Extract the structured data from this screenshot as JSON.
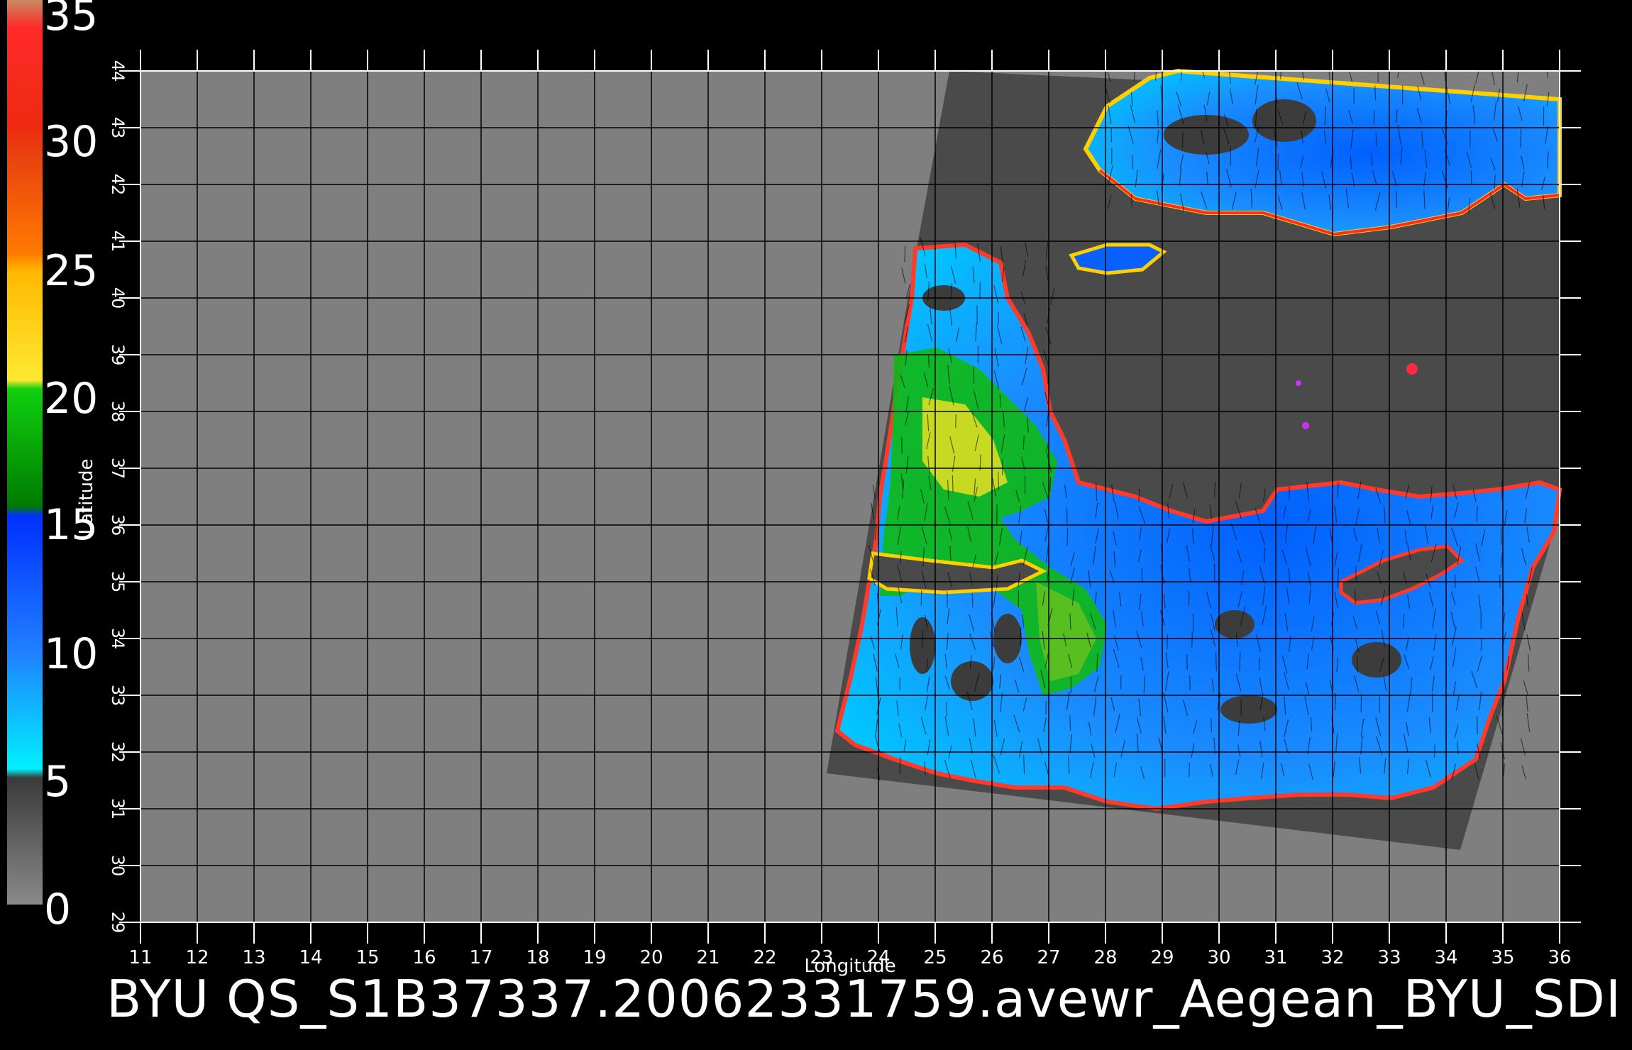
{
  "footer_title": "BYU  QS_S1B37337.20062331759.avewr_Aegean_BYU_SDI",
  "colorbar": {
    "labels": [
      "35",
      "30",
      "25",
      "20",
      "15",
      "10",
      "5",
      "0"
    ],
    "colors": [
      "#b97a57",
      "#ff2020",
      "#f05a10",
      "#ffd000",
      "#00c000",
      "#0050ff",
      "#00e8ff",
      "#606060"
    ]
  },
  "map": {
    "xlabel": "Longitude",
    "ylabel": "Latitude",
    "x_ticks": [
      "11",
      "12",
      "13",
      "14",
      "15",
      "16",
      "17",
      "18",
      "19",
      "20",
      "21",
      "22",
      "23",
      "24",
      "25",
      "26",
      "27",
      "28",
      "29",
      "30",
      "31",
      "32",
      "33",
      "34",
      "35",
      "36"
    ],
    "y_ticks": [
      "29",
      "30",
      "31",
      "32",
      "33",
      "34",
      "35",
      "36",
      "37",
      "38",
      "39",
      "40",
      "41",
      "42",
      "43",
      "44"
    ],
    "colors": {
      "background_gray": "#7f7f7f",
      "swath_dark": "#4a4a4a",
      "grid": "#000000"
    }
  }
}
